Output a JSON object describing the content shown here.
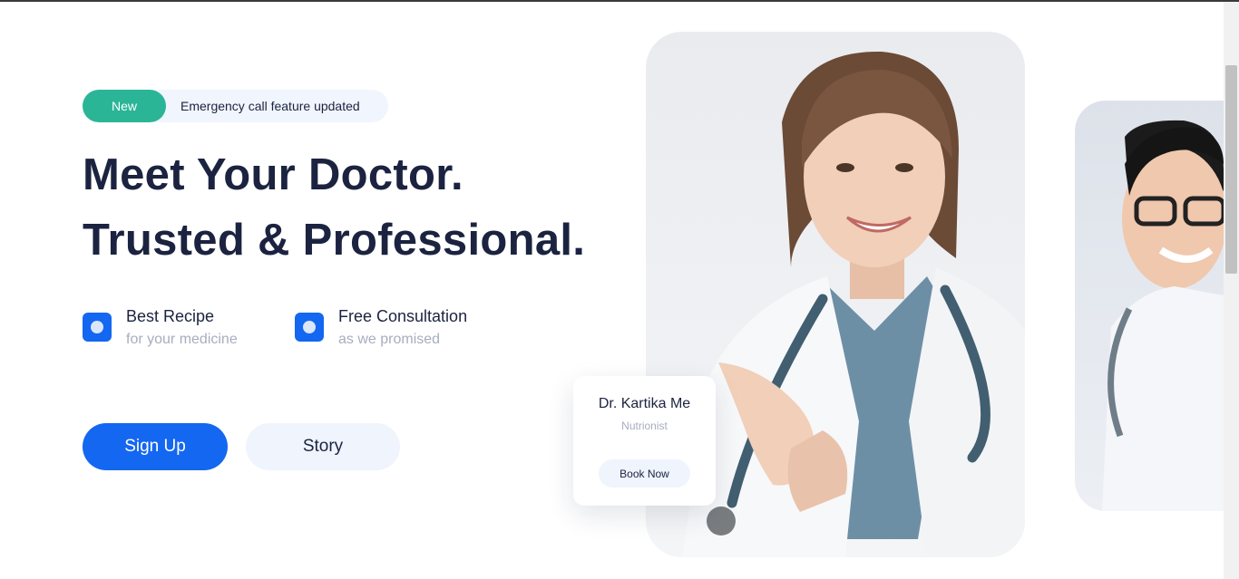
{
  "announcement": {
    "badge": "New",
    "text": "Emergency call feature updated"
  },
  "hero": {
    "line1": "Meet Your Doctor.",
    "line2": "Trusted & Professional."
  },
  "features": [
    {
      "title": "Best Recipe",
      "subtitle": "for your medicine",
      "icon": "check-square-icon"
    },
    {
      "title": "Free Consultation",
      "subtitle": "as we promised",
      "icon": "check-square-icon"
    }
  ],
  "buttons": {
    "signup": "Sign Up",
    "story": "Story"
  },
  "doctor_card": {
    "name": "Dr. Kartika Me",
    "role": "Nutrionist",
    "book": "Book Now"
  },
  "colors": {
    "primary": "#1467f0",
    "accent": "#2bb597",
    "heading": "#1b2340",
    "muted": "#a8adbf"
  }
}
